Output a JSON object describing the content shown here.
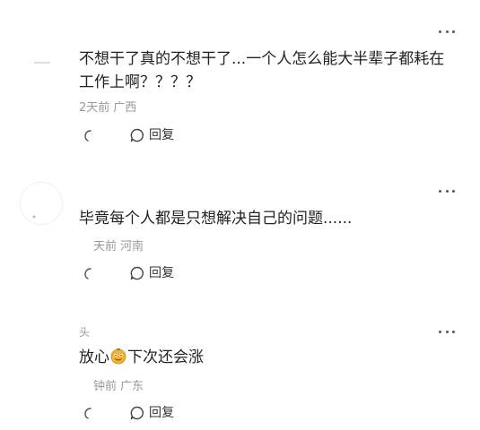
{
  "comments": [
    {
      "text": "不想干了真的不想干了...一个人怎么能大半辈子都耗在工作上啊？？？？",
      "time": "2天前",
      "region": "广西",
      "reply_label": "回复"
    },
    {
      "text": "毕竟每个人都是只想解决自己的问题......",
      "time": "天前",
      "region": "河南",
      "reply_label": "回复"
    },
    {
      "username": "头",
      "text_before": "放心",
      "emoji": "money-face-emoji",
      "text_after": "下次还会涨",
      "time": "钟前",
      "region": "广东",
      "reply_label": "回复"
    }
  ],
  "colors": {
    "text": "#222222",
    "meta": "#999999",
    "icon": "#555555"
  }
}
